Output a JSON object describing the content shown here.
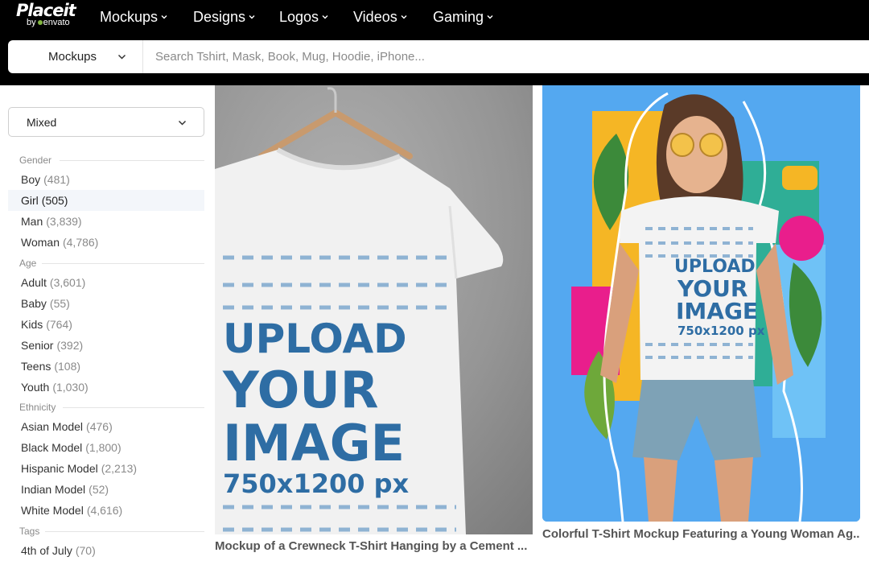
{
  "brand": {
    "name": "Placeit",
    "byline": "by envato"
  },
  "nav": {
    "items": [
      {
        "label": "Mockups"
      },
      {
        "label": "Designs"
      },
      {
        "label": "Logos"
      },
      {
        "label": "Videos"
      },
      {
        "label": "Gaming"
      }
    ]
  },
  "search": {
    "category": "Mockups",
    "placeholder": "Search Tshirt, Mask, Book, Mug, Hoodie, iPhone..."
  },
  "sidebar": {
    "sort": "Mixed",
    "groups": [
      {
        "title": "Gender",
        "options": [
          {
            "label": "Boy",
            "count": "(481)"
          },
          {
            "label": "Girl",
            "count": "(505)",
            "active": true
          },
          {
            "label": "Man",
            "count": "(3,839)"
          },
          {
            "label": "Woman",
            "count": "(4,786)"
          }
        ]
      },
      {
        "title": "Age",
        "options": [
          {
            "label": "Adult",
            "count": "(3,601)"
          },
          {
            "label": "Baby",
            "count": "(55)"
          },
          {
            "label": "Kids",
            "count": "(764)"
          },
          {
            "label": "Senior",
            "count": "(392)"
          },
          {
            "label": "Teens",
            "count": "(108)"
          },
          {
            "label": "Youth",
            "count": "(1,030)"
          }
        ]
      },
      {
        "title": "Ethnicity",
        "options": [
          {
            "label": "Asian Model",
            "count": "(476)"
          },
          {
            "label": "Black Model",
            "count": "(1,800)"
          },
          {
            "label": "Hispanic Model",
            "count": "(2,213)"
          },
          {
            "label": "Indian Model",
            "count": "(52)"
          },
          {
            "label": "White Model",
            "count": "(4,616)"
          }
        ]
      },
      {
        "title": "Tags",
        "options": [
          {
            "label": "4th of July",
            "count": "(70)"
          }
        ]
      }
    ]
  },
  "cards": [
    {
      "title": "Mockup of a Crewneck T-Shirt Hanging by a Cement ...",
      "shirt_text": [
        "UPLOAD",
        "YOUR",
        "IMAGE",
        "750x1200 px"
      ]
    },
    {
      "title": "Colorful T-Shirt Mockup Featuring a Young Woman Ag...",
      "shirt_text": [
        "UPLOAD",
        "YOUR",
        "IMAGE",
        "750x1200 px"
      ]
    }
  ],
  "colors": {
    "accent_green": "#82b541",
    "shirt_text": "#2e6da4",
    "card2_bg": "#54a8f0"
  }
}
